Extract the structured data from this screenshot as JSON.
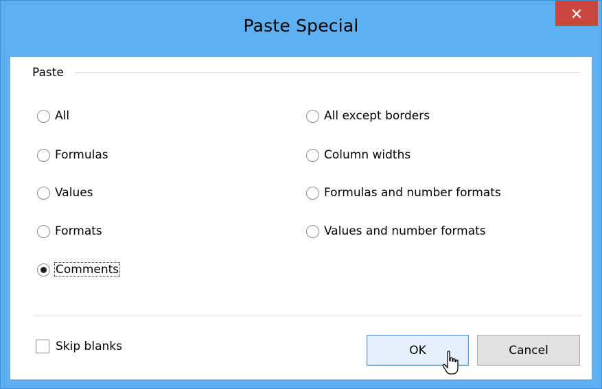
{
  "dialog": {
    "title": "Paste Special",
    "close_icon": "close-icon (×)"
  },
  "paste_group": {
    "label": "Paste",
    "left_options": [
      {
        "label": "All",
        "selected": false
      },
      {
        "label": "Formulas",
        "selected": false
      },
      {
        "label": "Values",
        "selected": false
      },
      {
        "label": "Formats",
        "selected": false
      },
      {
        "label": "Comments",
        "selected": true,
        "focused": true
      }
    ],
    "right_options": [
      {
        "label": "All except borders",
        "selected": false
      },
      {
        "label": "Column widths",
        "selected": false
      },
      {
        "label": "Formulas and number formats",
        "selected": false
      },
      {
        "label": "Values and number formats",
        "selected": false
      }
    ]
  },
  "skip_blanks": {
    "label": "Skip blanks",
    "checked": false
  },
  "buttons": {
    "ok": "OK",
    "cancel": "Cancel"
  },
  "colors": {
    "titlebar": "#5fb0f3",
    "close_button": "#c9463d",
    "ok_button_border": "#5b9bd5"
  },
  "cursor": "pointer-hand-icon"
}
